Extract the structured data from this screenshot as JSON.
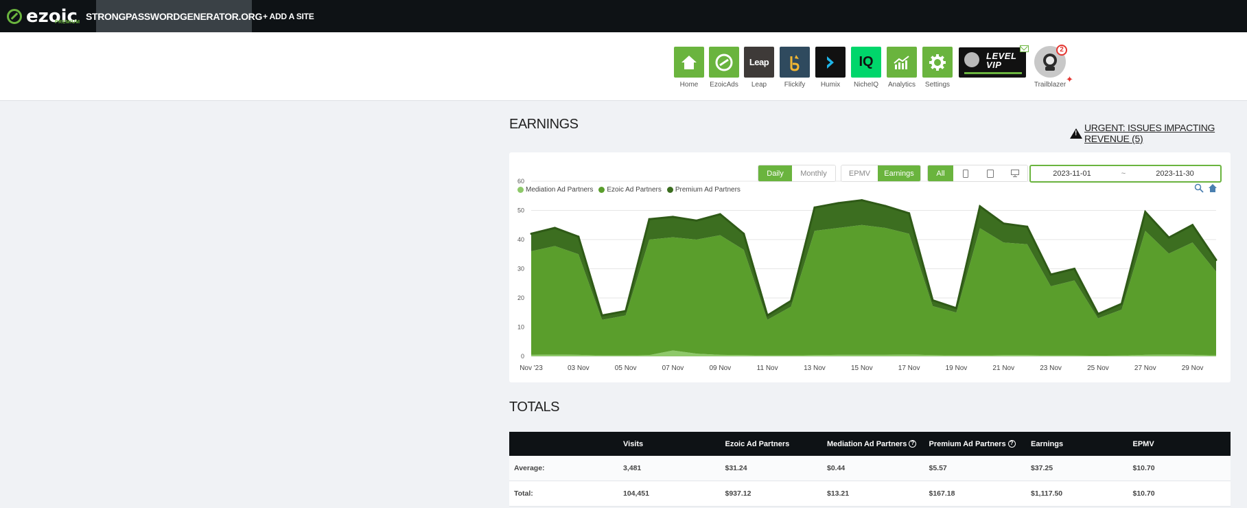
{
  "brand": {
    "name": "ezoic",
    "tier": "PREMIUM",
    "accent": "#6ab43e"
  },
  "topbar": {
    "site": "STRONGPASSWORDGENERATOR.ORG",
    "add_site": "+ ADD A SITE"
  },
  "apps": [
    {
      "label": "Home",
      "icon": "home-icon"
    },
    {
      "label": "EzoicAds",
      "icon": "ezoic-ads-icon"
    },
    {
      "label": "Leap",
      "icon": "leap-icon",
      "text": "Leap"
    },
    {
      "label": "Flickify",
      "icon": "flickify-icon"
    },
    {
      "label": "Humix",
      "icon": "humix-icon"
    },
    {
      "label": "NicheIQ",
      "icon": "nicheiq-icon",
      "text": "IQ"
    },
    {
      "label": "Analytics",
      "icon": "analytics-icon"
    },
    {
      "label": "Settings",
      "icon": "gear-icon"
    }
  ],
  "level": {
    "line1": "LEVEL",
    "line2": "VIP"
  },
  "trailblazer": {
    "label": "Trailblazer",
    "badge": "2"
  },
  "earnings": {
    "title": "EARNINGS",
    "urgent": "URGENT: ISSUES IMPACTING REVENUE (5)",
    "period_buttons": [
      "Daily",
      "Monthly"
    ],
    "period_active": "Daily",
    "metric_buttons": [
      "EPMV",
      "Earnings"
    ],
    "metric_active": "Earnings",
    "device_buttons": {
      "all": "All",
      "icons": [
        "mobile-icon",
        "tablet-icon",
        "desktop-icon"
      ]
    },
    "date_from": "2023-11-01",
    "date_sep": "~",
    "date_to": "2023-11-30"
  },
  "chart_data": {
    "type": "area",
    "stacked": true,
    "x": [
      "2023-11-01",
      "2023-11-02",
      "2023-11-03",
      "2023-11-04",
      "2023-11-05",
      "2023-11-06",
      "2023-11-07",
      "2023-11-08",
      "2023-11-09",
      "2023-11-10",
      "2023-11-11",
      "2023-11-12",
      "2023-11-13",
      "2023-11-14",
      "2023-11-15",
      "2023-11-16",
      "2023-11-17",
      "2023-11-18",
      "2023-11-19",
      "2023-11-20",
      "2023-11-21",
      "2023-11-22",
      "2023-11-23",
      "2023-11-24",
      "2023-11-25",
      "2023-11-26",
      "2023-11-27",
      "2023-11-28",
      "2023-11-29",
      "2023-11-30"
    ],
    "tick_labels": [
      "Nov '23",
      "03 Nov",
      "05 Nov",
      "07 Nov",
      "09 Nov",
      "11 Nov",
      "13 Nov",
      "15 Nov",
      "17 Nov",
      "19 Nov",
      "21 Nov",
      "23 Nov",
      "25 Nov",
      "27 Nov",
      "29 Nov"
    ],
    "series": [
      {
        "name": "Mediation Ad Partners",
        "color": "#8ec96a",
        "values": [
          0.5,
          0.6,
          0.5,
          0.3,
          0.3,
          0.4,
          2.0,
          0.9,
          0.5,
          0.4,
          0.3,
          0.3,
          0.4,
          0.5,
          0.5,
          0.5,
          0.6,
          0.4,
          0.3,
          0.3,
          0.4,
          0.4,
          0.3,
          0.3,
          0.2,
          0.3,
          0.5,
          0.6,
          0.5,
          0.3
        ]
      },
      {
        "name": "Ezoic Ad Partners",
        "color": "#5a9e2c",
        "values": [
          35.5,
          37.2,
          34.5,
          12.2,
          13.7,
          39.6,
          38.8,
          39.1,
          41.0,
          36.1,
          12.2,
          16.7,
          42.6,
          43.5,
          44.5,
          43.5,
          41.4,
          16.8,
          14.7,
          43.6,
          38.6,
          38.0,
          23.7,
          25.7,
          12.8,
          15.7,
          42.5,
          34.6,
          38.5,
          28.7
        ]
      },
      {
        "name": "Premium Ad Partners",
        "color": "#3c6e20",
        "values": [
          6.0,
          6.2,
          6.0,
          1.5,
          1.5,
          7.0,
          7.0,
          6.5,
          7.2,
          5.5,
          1.5,
          2.0,
          8.0,
          8.5,
          8.5,
          7.5,
          7.0,
          2.0,
          1.5,
          7.5,
          6.5,
          6.0,
          4.0,
          4.0,
          1.5,
          2.0,
          6.5,
          5.5,
          6.0,
          4.0
        ]
      }
    ],
    "ylim": [
      0,
      60
    ],
    "yticks": [
      0,
      10,
      20,
      30,
      40,
      50,
      60
    ],
    "grid": true,
    "legend": "top-left"
  },
  "totals": {
    "title": "TOTALS",
    "headers": [
      "",
      "Visits",
      "Ezoic Ad Partners",
      "Mediation Ad Partners",
      "Premium Ad Partners",
      "Earnings",
      "EPMV"
    ],
    "rows": [
      [
        "Average:",
        "3,481",
        "$31.24",
        "$0.44",
        "$5.57",
        "$37.25",
        "$10.70"
      ],
      [
        "Total:",
        "104,451",
        "$937.12",
        "$13.21",
        "$167.18",
        "$1,117.50",
        "$10.70"
      ]
    ]
  }
}
